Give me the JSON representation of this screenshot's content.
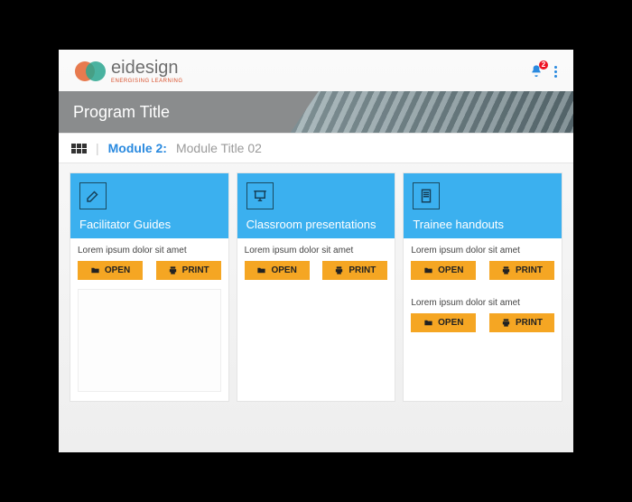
{
  "brand": {
    "name": "eidesign",
    "tagline": "ENERGISING LEARNING"
  },
  "notifications": {
    "count": "2"
  },
  "hero": {
    "title": "Program Title"
  },
  "breadcrumb": {
    "module_label": "Module 2:",
    "module_title": "Module Title 02"
  },
  "buttons": {
    "open": "OPEN",
    "print": "PRINT"
  },
  "cards": [
    {
      "title": "Facilitator Guides",
      "items": [
        {
          "desc": "Lorem ipsum dolor sit amet"
        }
      ]
    },
    {
      "title": "Classroom presentations",
      "items": [
        {
          "desc": "Lorem ipsum dolor sit amet"
        }
      ]
    },
    {
      "title": "Trainee handouts",
      "items": [
        {
          "desc": "Lorem ipsum dolor sit amet"
        },
        {
          "desc": "Lorem ipsum dolor sit amet"
        }
      ]
    }
  ]
}
